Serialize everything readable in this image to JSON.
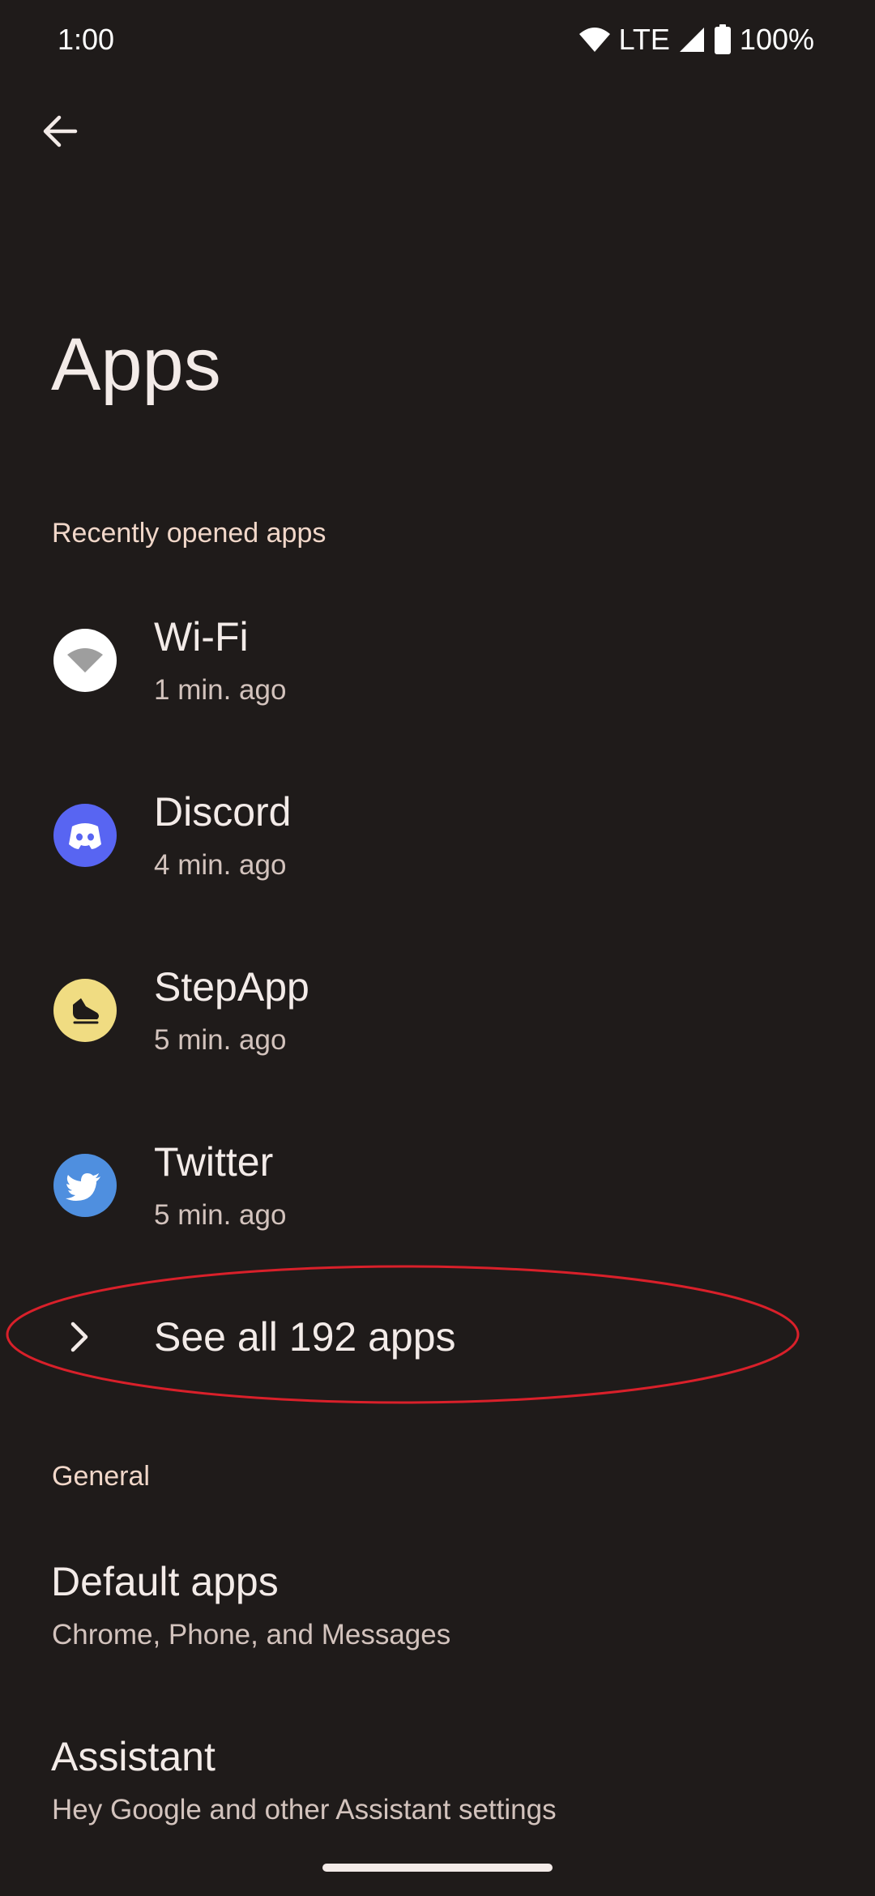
{
  "status_bar": {
    "time": "1:00",
    "network": "LTE",
    "battery": "100%",
    "icons": [
      "wifi-icon",
      "signal-icon",
      "battery-icon"
    ]
  },
  "header": {
    "back_icon": "back-arrow-icon",
    "title": "Apps"
  },
  "recent": {
    "section_label": "Recently opened apps",
    "apps": [
      {
        "name": "Wi-Fi",
        "time": "1 min. ago",
        "icon": "wifi-app-icon",
        "icon_color": "#ffffff"
      },
      {
        "name": "Discord",
        "time": "4 min. ago",
        "icon": "discord-icon",
        "icon_color": "#5865f2"
      },
      {
        "name": "StepApp",
        "time": "5 min. ago",
        "icon": "stepapp-icon",
        "icon_color": "#f0dc82"
      },
      {
        "name": "Twitter",
        "time": "5 min. ago",
        "icon": "twitter-icon",
        "icon_color": "#4f8fdf"
      }
    ],
    "see_all_label": "See all 192 apps",
    "see_all_icon": "chevron-right-icon"
  },
  "annotation": {
    "shape": "ellipse",
    "color": "#d9202a",
    "target": "See all 192 apps"
  },
  "general": {
    "section_label": "General",
    "items": [
      {
        "title": "Default apps",
        "summary": "Chrome, Phone, and Messages"
      },
      {
        "title": "Assistant",
        "summary": "Hey Google and other Assistant settings"
      }
    ]
  },
  "colors": {
    "background": "#1f1b1a",
    "text_primary": "#f3ebe8",
    "text_secondary": "#d3c3bd",
    "section_header": "#f1d7c9"
  }
}
